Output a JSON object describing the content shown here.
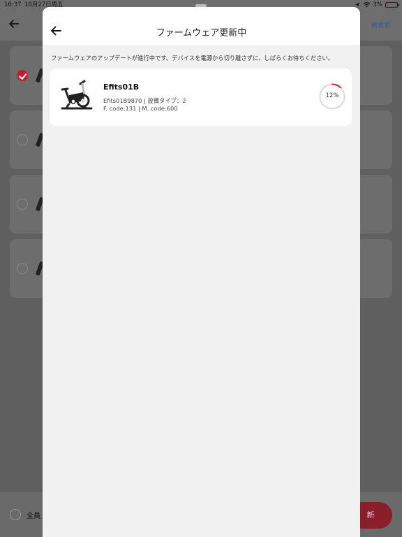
{
  "status_bar": {
    "time": "16:37",
    "date": "10月27日周五",
    "battery": "3%"
  },
  "background": {
    "research_label": "再検索",
    "select_all_label": "全員",
    "update_button_label": "新"
  },
  "sheet": {
    "title": "ファームウェア更新中",
    "notice": "ファームウェアのアップデートが進行中です。デバイスを電源から切り離さずに、しばらくお待ちください。",
    "device": {
      "name": "Efits01B",
      "meta_line1": "Efits01B9870 | 設備タイプ：2",
      "meta_line2": "F. code:131 | M. code:600",
      "icon": "exercise-bike-icon",
      "progress": 12,
      "progress_label": "12%"
    }
  },
  "colors": {
    "accent": "#d02030",
    "sheet_bg": "#f1f1f1",
    "card_bg": "#ffffff",
    "ring_track": "#d9d9d9"
  }
}
